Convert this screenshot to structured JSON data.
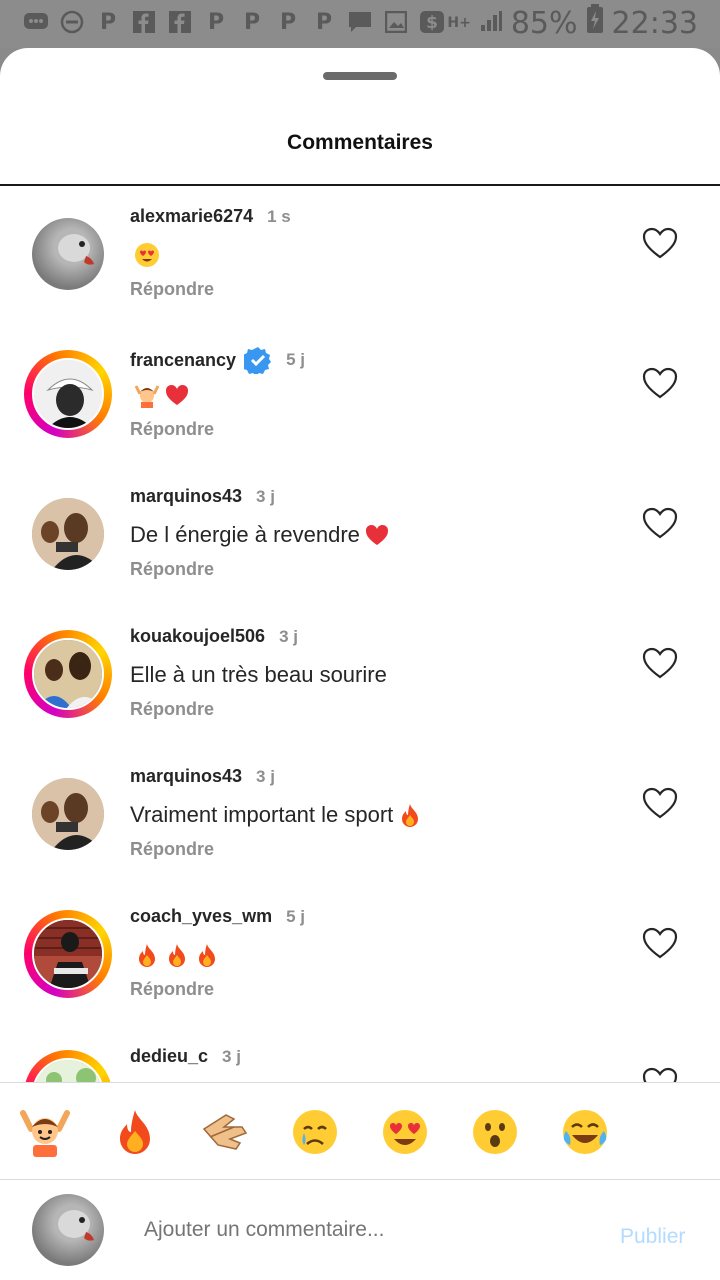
{
  "status_bar": {
    "battery": "85%",
    "time": "22:33",
    "network": "H+",
    "left_icons": [
      "chat-icon",
      "do-not-disturb-icon",
      "p-icon",
      "facebook-icon",
      "facebook-icon",
      "p-icon",
      "p-icon",
      "p-icon",
      "p-icon",
      "message-icon",
      "image-icon",
      "dollar-icon"
    ]
  },
  "sheet": {
    "title": "Commentaires"
  },
  "comments": [
    {
      "user": "alexmarie6274",
      "time": "1 s",
      "text": "",
      "emojis": [
        "heart-eyes"
      ],
      "reply": "Répondre",
      "verified": false,
      "ring": false,
      "avatar_color": "#8c8c8c"
    },
    {
      "user": "francenancy",
      "time": "5 j",
      "text": "",
      "emojis": [
        "raising-hands-person",
        "red-heart"
      ],
      "reply": "Répondre",
      "verified": true,
      "ring": true,
      "avatar_color": "#3a3a3a"
    },
    {
      "user": "marquinos43",
      "time": "3 j",
      "text": "De l énergie à revendre",
      "emojis": [
        "red-heart"
      ],
      "reply": "Répondre",
      "verified": false,
      "ring": false,
      "avatar_color": "#5a3a2a"
    },
    {
      "user": "kouakoujoel506",
      "time": "3 j",
      "text": "Elle à un très beau sourire",
      "emojis": [],
      "reply": "Répondre",
      "verified": false,
      "ring": true,
      "avatar_color": "#3b6fb5"
    },
    {
      "user": "marquinos43",
      "time": "3 j",
      "text": "Vraiment important le sport",
      "emojis": [
        "fire"
      ],
      "reply": "Répondre",
      "verified": false,
      "ring": false,
      "avatar_color": "#5a3a2a"
    },
    {
      "user": "coach_yves_wm",
      "time": "5 j",
      "text": "",
      "emojis": [
        "fire",
        "fire",
        "fire"
      ],
      "reply": "Répondre",
      "verified": false,
      "ring": true,
      "avatar_color": "#2a2a2a"
    },
    {
      "user": "dedieu_c",
      "time": "3 j",
      "text": "",
      "emojis": [],
      "reply": "",
      "verified": false,
      "ring": true,
      "avatar_color": "#9ccf8a"
    }
  ],
  "reactions": [
    "raising-hands",
    "fire",
    "clapping-hands",
    "crying-face",
    "heart-eyes",
    "surprised-face",
    "tears-of-joy"
  ],
  "composer": {
    "placeholder": "Ajouter un commentaire...",
    "publish_label": "Publier"
  },
  "colors": {
    "publish": "#b3dbff",
    "verified": "#3897f0",
    "ring_start": "#d300c5",
    "ring_end": "#ffd600"
  }
}
